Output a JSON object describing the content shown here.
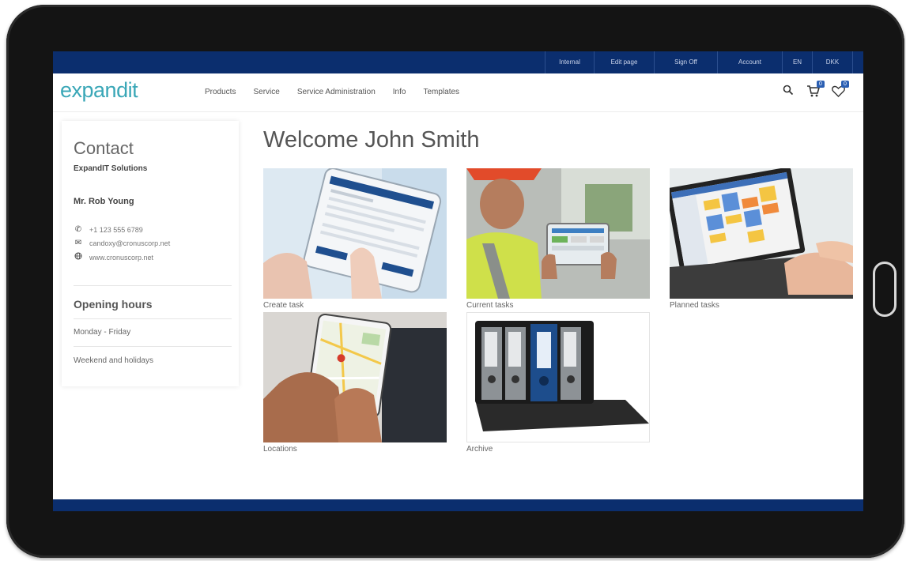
{
  "topbar": {
    "links": [
      {
        "label": "Internal"
      },
      {
        "label": "Edit page"
      },
      {
        "label": "Sign Off"
      },
      {
        "label": "Account"
      },
      {
        "label": "EN"
      },
      {
        "label": "DKK"
      }
    ]
  },
  "header": {
    "logo": "expandit",
    "nav": [
      "Products",
      "Service",
      "Service Administration",
      "Info",
      "Templates"
    ],
    "cart_count": "0",
    "wishlist_count": "0"
  },
  "contact": {
    "title": "Contact",
    "company": "ExpandIT Solutions",
    "person": "Mr. Rob Young",
    "phone": "+1 123 555 6789",
    "email": "candoxy@cronuscorp.net",
    "website": "www.cronuscorp.net",
    "hours_title": "Opening hours",
    "hours": [
      "Monday - Friday",
      "Weekend and holidays"
    ]
  },
  "main": {
    "welcome": "Welcome John Smith",
    "tiles": [
      {
        "caption": "Create task"
      },
      {
        "caption": "Current tasks"
      },
      {
        "caption": "Planned tasks"
      },
      {
        "caption": "Locations"
      },
      {
        "caption": "Archive"
      }
    ]
  },
  "colors": {
    "brand_navy": "#0b2e6e",
    "logo_teal": "#3aa7b7",
    "badge_blue": "#2b5fb3"
  }
}
